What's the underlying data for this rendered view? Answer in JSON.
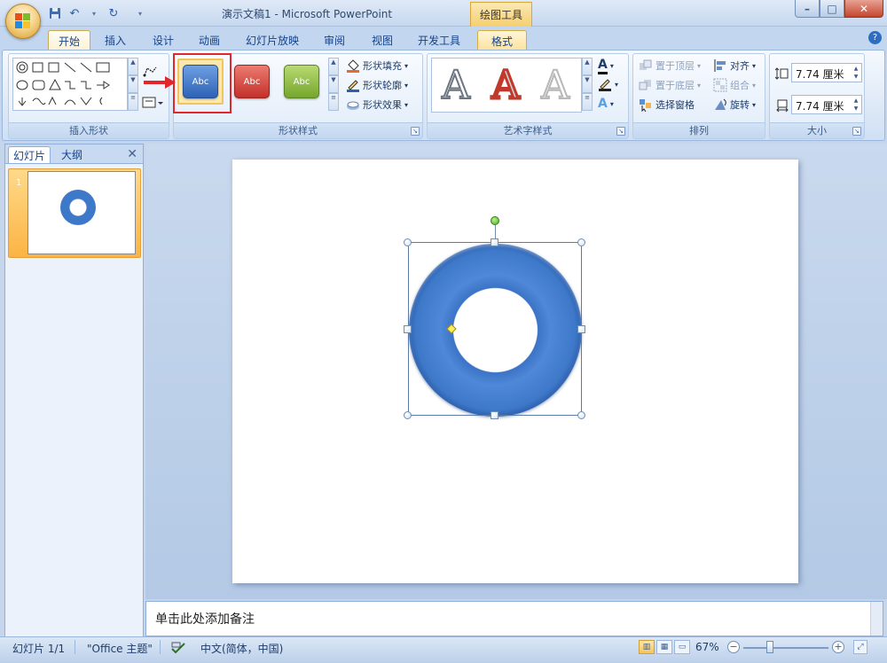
{
  "window": {
    "title": "演示文稿1 - Microsoft PowerPoint",
    "contextual_tools": "绘图工具",
    "qat_icons": [
      "save-icon",
      "undo-icon",
      "redo-icon",
      "customize-icon"
    ]
  },
  "tabs": [
    "开始",
    "插入",
    "设计",
    "动画",
    "幻灯片放映",
    "审阅",
    "视图",
    "开发工具",
    "格式"
  ],
  "active_tab": "格式",
  "ribbon": {
    "insert_shapes": {
      "label": "插入形状"
    },
    "shape_styles": {
      "label": "形状样式",
      "swatches": [
        "Abc",
        "Abc",
        "Abc"
      ],
      "fill": "形状填充",
      "outline": "形状轮廓",
      "effects": "形状效果"
    },
    "wordart": {
      "label": "艺术字样式",
      "letters": [
        "A",
        "A",
        "A"
      ]
    },
    "arrange": {
      "label": "排列",
      "bring_front": "置于顶层",
      "send_back": "置于底层",
      "selection_pane": "选择窗格",
      "align": "对齐",
      "group": "组合",
      "rotate": "旋转"
    },
    "size": {
      "label": "大小",
      "height": "7.74 厘米",
      "width": "7.74 厘米"
    }
  },
  "left_pane": {
    "tab_slides": "幻灯片",
    "tab_outline": "大纲",
    "slide_number": "1"
  },
  "notes": {
    "placeholder": "单击此处添加备注"
  },
  "status": {
    "slide": "幻灯片 1/1",
    "theme": "\"Office 主题\"",
    "language": "中文(简体，中国)",
    "zoom": "67%"
  },
  "colors": {
    "donut": "#3e78c9",
    "highlight": "#e2262a"
  }
}
